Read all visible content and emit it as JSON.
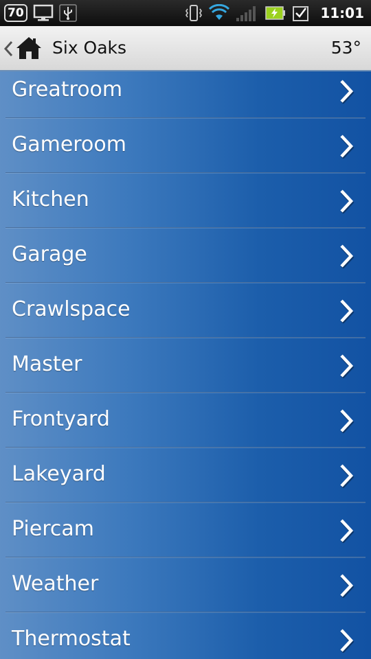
{
  "status_bar": {
    "badge": "70",
    "time": "11:01",
    "icons": [
      "monitor-icon",
      "usb-icon",
      "vibrate-icon",
      "wifi-icon",
      "signal-icon",
      "battery-charging-icon",
      "checkbox-notification-icon"
    ]
  },
  "header": {
    "title": "Six Oaks",
    "temperature": "53°",
    "icons": [
      "back-chevron-icon",
      "home-icon"
    ]
  },
  "rooms": [
    {
      "label": "Greatroom"
    },
    {
      "label": "Gameroom"
    },
    {
      "label": "Kitchen"
    },
    {
      "label": "Garage"
    },
    {
      "label": "Crawlspace"
    },
    {
      "label": "Master"
    },
    {
      "label": "Frontyard"
    },
    {
      "label": "Lakeyard"
    },
    {
      "label": "Piercam"
    },
    {
      "label": "Weather"
    },
    {
      "label": "Thermostat"
    }
  ],
  "colors": {
    "list_left": "#5f8fc6",
    "list_right": "#1252a3",
    "text": "#ffffff",
    "status_bar": "#111111",
    "header_bg": "#e6e6e6",
    "battery_fill": "#9bd11f",
    "wifi": "#35a7e0"
  }
}
